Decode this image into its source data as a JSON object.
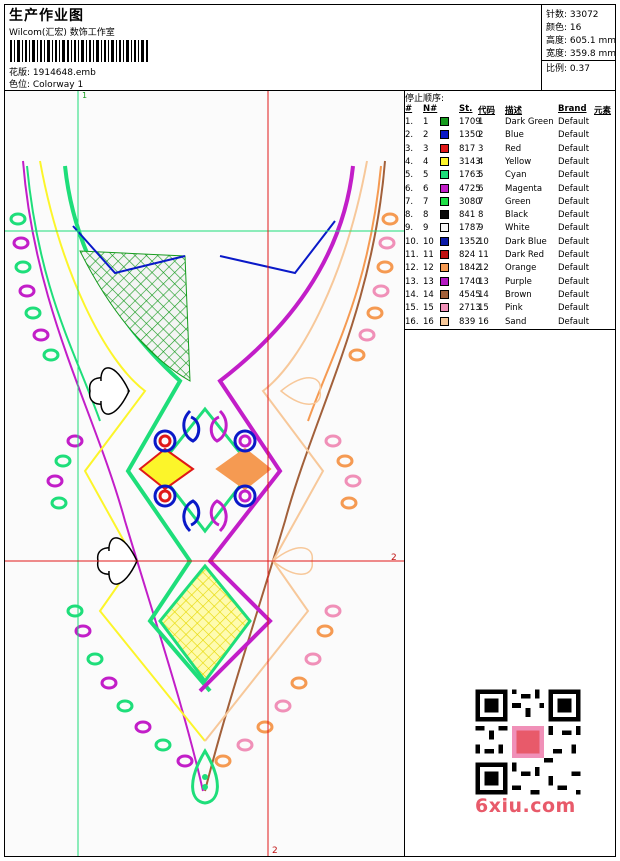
{
  "header": {
    "title": "生产作业图",
    "company": "Wilcom(汇宏) 数饰工作室",
    "design_label": "花版: 1914648.emb",
    "colorway_label": "色位: Colorway 1"
  },
  "stats": {
    "stitches": "针数: 33072",
    "colors": "颜色: 16",
    "height": "高度: 605.1 mm",
    "width": "宽度: 359.8 mm",
    "scale": "比例: 0.37"
  },
  "stop_sequence": {
    "caption": "停止顺序:",
    "headers": {
      "idx": "#",
      "no": "N#",
      "st": "St.",
      "code": "代码",
      "desc": "描述",
      "brand": "Brand",
      "element": "元素"
    },
    "rows": [
      {
        "idx": "1.",
        "no": "1",
        "color": "#169b1e",
        "st": "1709",
        "code": "1",
        "desc": "Dark Green",
        "brand": "Default"
      },
      {
        "idx": "2.",
        "no": "2",
        "color": "#0a19c8",
        "st": "1350",
        "code": "2",
        "desc": "Blue",
        "brand": "Default"
      },
      {
        "idx": "3.",
        "no": "3",
        "color": "#e01818",
        "st": "817",
        "code": "3",
        "desc": "Red",
        "brand": "Default"
      },
      {
        "idx": "4.",
        "no": "4",
        "color": "#fcf52a",
        "st": "3143",
        "code": "4",
        "desc": "Yellow",
        "brand": "Default"
      },
      {
        "idx": "5.",
        "no": "5",
        "color": "#1ede7a",
        "st": "1763",
        "code": "5",
        "desc": "Cyan",
        "brand": "Default"
      },
      {
        "idx": "6.",
        "no": "6",
        "color": "#c21ec8",
        "st": "4725",
        "code": "6",
        "desc": "Magenta",
        "brand": "Default"
      },
      {
        "idx": "7.",
        "no": "7",
        "color": "#1ee046",
        "st": "3080",
        "code": "7",
        "desc": "Green",
        "brand": "Default"
      },
      {
        "idx": "8.",
        "no": "8",
        "color": "#0a0a0a",
        "st": "841",
        "code": "8",
        "desc": "Black",
        "brand": "Default"
      },
      {
        "idx": "9.",
        "no": "9",
        "color": "#f6f6f6",
        "st": "1787",
        "code": "9",
        "desc": "White",
        "brand": "Default"
      },
      {
        "idx": "10.",
        "no": "10",
        "color": "#0c1aa8",
        "st": "1352",
        "code": "10",
        "desc": "Dark Blue",
        "brand": "Default"
      },
      {
        "idx": "11.",
        "no": "11",
        "color": "#c01212",
        "st": "824",
        "code": "11",
        "desc": "Dark Red",
        "brand": "Default"
      },
      {
        "idx": "12.",
        "no": "12",
        "color": "#f59a52",
        "st": "1842",
        "code": "12",
        "desc": "Orange",
        "brand": "Default"
      },
      {
        "idx": "13.",
        "no": "13",
        "color": "#b418c2",
        "st": "1740",
        "code": "13",
        "desc": "Purple",
        "brand": "Default"
      },
      {
        "idx": "14.",
        "no": "14",
        "color": "#a2603a",
        "st": "4545",
        "code": "14",
        "desc": "Brown",
        "brand": "Default"
      },
      {
        "idx": "15.",
        "no": "15",
        "color": "#f090b8",
        "st": "2713",
        "code": "15",
        "desc": "Pink",
        "brand": "Default"
      },
      {
        "idx": "16.",
        "no": "16",
        "color": "#f7c89a",
        "st": "839",
        "code": "16",
        "desc": "Sand",
        "brand": "Default"
      }
    ]
  },
  "guides": {
    "label_1_top": "1",
    "label_2_right": "2",
    "label_2_bottom": "2"
  },
  "watermark": "6xiu.com"
}
